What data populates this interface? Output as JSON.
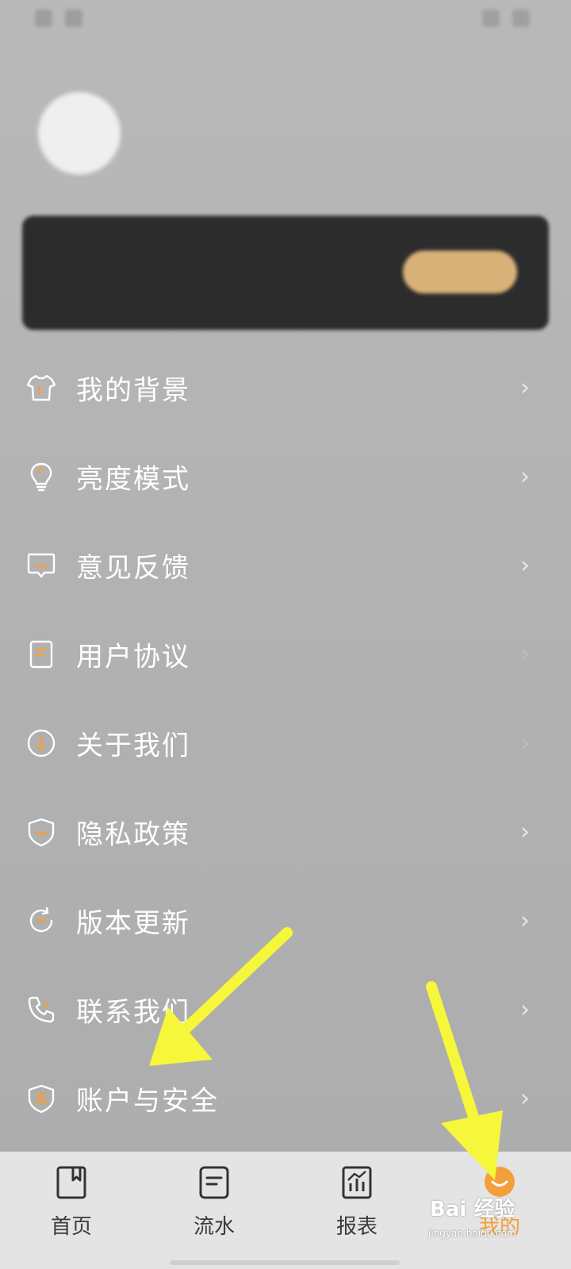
{
  "status_bar": {
    "time": "",
    "battery": ""
  },
  "profile": {
    "username": ""
  },
  "member_card": {
    "title": "",
    "subtitle": "",
    "button": ""
  },
  "menu": [
    {
      "label": "我的背景",
      "icon": "tshirt-icon",
      "chevron": true
    },
    {
      "label": "亮度模式",
      "icon": "lightbulb-icon",
      "chevron": true
    },
    {
      "label": "意见反馈",
      "icon": "feedback-chat-icon",
      "chevron": true
    },
    {
      "label": "用户协议",
      "icon": "document-icon",
      "chevron": false
    },
    {
      "label": "关于我们",
      "icon": "info-circle-icon",
      "chevron": false
    },
    {
      "label": "隐私政策",
      "icon": "shield-icon",
      "chevron": true
    },
    {
      "label": "版本更新",
      "icon": "refresh-icon",
      "chevron": true
    },
    {
      "label": "联系我们",
      "icon": "phone-icon",
      "chevron": true
    },
    {
      "label": "账户与安全",
      "icon": "shield-user-icon",
      "chevron": true
    }
  ],
  "chevron_glyph": "›",
  "bottom_nav": {
    "tabs": [
      {
        "label": "首页",
        "icon": "bookmark-book-icon",
        "active": false
      },
      {
        "label": "流水",
        "icon": "list-note-icon",
        "active": false
      },
      {
        "label": "报表",
        "icon": "chart-icon",
        "active": false
      },
      {
        "label": "我的",
        "icon": "orange-face-icon",
        "active": true
      }
    ]
  },
  "watermark": {
    "brand": "Bai 经验",
    "site": "jingyan.baidu.com"
  },
  "colors": {
    "accent": "#f3a03b",
    "overlay_arrow": "#f6f63a",
    "menu_text": "#ffffff"
  }
}
